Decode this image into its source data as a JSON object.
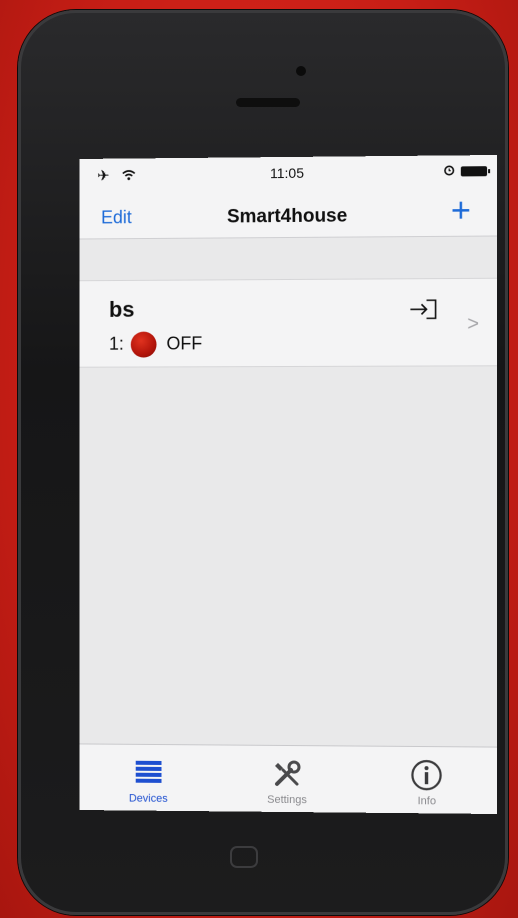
{
  "status_bar": {
    "left_icons": [
      "airplane-icon",
      "wifi-icon"
    ],
    "time": "11:05",
    "right_icons": [
      "alarm-icon",
      "battery-icon"
    ]
  },
  "nav": {
    "edit_label": "Edit",
    "title": "Smart4house",
    "add_label": "+"
  },
  "devices": [
    {
      "name": "bs",
      "index_label": "1:",
      "state": "OFF",
      "led_color": "#c01a0e",
      "action_icon": "connect-icon"
    }
  ],
  "tabs": [
    {
      "label": "Devices",
      "icon": "list-icon",
      "active": true
    },
    {
      "label": "Settings",
      "icon": "tools-icon",
      "active": false
    },
    {
      "label": "Info",
      "icon": "info-icon",
      "active": false
    }
  ],
  "colors": {
    "accent": "#1e6bd8",
    "tab_active": "#1e4fd0",
    "tab_inactive": "#8a8a8e"
  }
}
